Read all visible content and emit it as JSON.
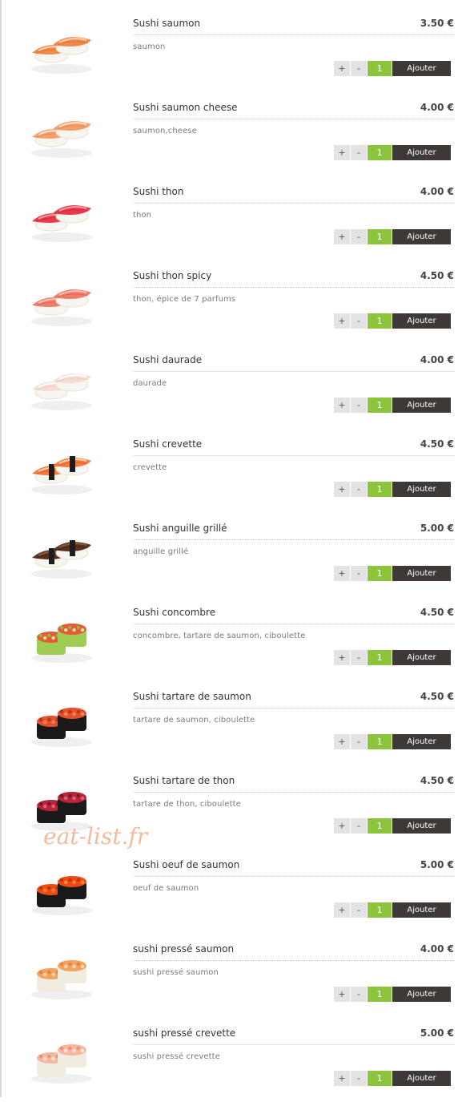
{
  "menu": {
    "items": [
      {
        "name": "Sushi saumon",
        "price": "3.50 €",
        "description": "saumon",
        "qty": "1",
        "plus": "+",
        "minus": "-",
        "add_label": "Ajouter",
        "icon": "salmon-nigiri-icon",
        "style": {
          "fish": "#f08a4b",
          "stripe": "#fbd3b5",
          "dark": "#d95f24",
          "band": null
        }
      },
      {
        "name": "Sushi saumon cheese",
        "price": "4.00 €",
        "description": "saumon,cheese",
        "qty": "1",
        "plus": "+",
        "minus": "-",
        "add_label": "Ajouter",
        "icon": "salmon-cheese-nigiri-icon",
        "style": {
          "fish": "#f4a06b",
          "stripe": "#fbe3d2",
          "dark": "#e27d43",
          "band": null
        }
      },
      {
        "name": "Sushi thon",
        "price": "4.00 €",
        "description": "thon",
        "qty": "1",
        "plus": "+",
        "minus": "-",
        "add_label": "Ajouter",
        "icon": "tuna-nigiri-icon",
        "style": {
          "fish": "#e9394a",
          "stripe": "#f7a0a8",
          "dark": "#c51f32",
          "band": null
        }
      },
      {
        "name": "Sushi thon spicy",
        "price": "4.50 €",
        "description": "thon, épice de 7 parfums",
        "qty": "1",
        "plus": "+",
        "minus": "-",
        "add_label": "Ajouter",
        "icon": "spicy-tuna-nigiri-icon",
        "style": {
          "fish": "#f07d6a",
          "stripe": "#f8c0b4",
          "dark": "#d9584a",
          "band": null
        }
      },
      {
        "name": "Sushi daurade",
        "price": "4.00 €",
        "description": "daurade",
        "qty": "1",
        "plus": "+",
        "minus": "-",
        "add_label": "Ajouter",
        "icon": "sea-bream-nigiri-icon",
        "style": {
          "fish": "#f6ddd3",
          "stripe": "#ffffff",
          "dark": "#e8bfb0",
          "band": null
        }
      },
      {
        "name": "Sushi crevette",
        "price": "4.50 €",
        "description": "crevette",
        "qty": "1",
        "plus": "+",
        "minus": "-",
        "add_label": "Ajouter",
        "icon": "shrimp-nigiri-icon",
        "style": {
          "fish": "#f27a3c",
          "stripe": "#fbd2b4",
          "dark": "#d4561c",
          "band": "#1d1d1d"
        }
      },
      {
        "name": "Sushi anguille grillé",
        "price": "5.00 €",
        "description": "anguille grillé",
        "qty": "1",
        "plus": "+",
        "minus": "-",
        "add_label": "Ajouter",
        "icon": "grilled-eel-nigiri-icon",
        "style": {
          "fish": "#5a3220",
          "stripe": "#8a5a3a",
          "dark": "#3a1e10",
          "band": "#1d1d1d"
        }
      },
      {
        "name": "Sushi concombre",
        "price": "4.50 €",
        "description": "concombre, tartare de saumon, ciboulette",
        "qty": "1",
        "plus": "+",
        "minus": "-",
        "add_label": "Ajouter",
        "icon": "cucumber-gunkan-icon",
        "style": {
          "fish": "#e8583a",
          "stripe": "#d9e8a0",
          "dark": "#8bbf3a",
          "band": "#9fcc52"
        }
      },
      {
        "name": "Sushi tartare de saumon",
        "price": "4.50 €",
        "description": "tartare de saumon, ciboulette",
        "qty": "1",
        "plus": "+",
        "minus": "-",
        "add_label": "Ajouter",
        "icon": "salmon-tartare-gunkan-icon",
        "style": {
          "fish": "#e6502c",
          "stripe": "#f28a5a",
          "dark": "#b8361a",
          "band": "#1a1a1a"
        }
      },
      {
        "name": "Sushi tartare de thon",
        "price": "4.50 €",
        "description": "tartare de thon, ciboulette",
        "qty": "1",
        "plus": "+",
        "minus": "-",
        "add_label": "Ajouter",
        "icon": "tuna-tartare-gunkan-icon",
        "style": {
          "fish": "#b8243a",
          "stripe": "#d9647a",
          "dark": "#7a1424",
          "band": "#1a1a1a"
        }
      },
      {
        "name": "Sushi oeuf de saumon",
        "price": "5.00 €",
        "description": "oeuf de saumon",
        "qty": "1",
        "plus": "+",
        "minus": "-",
        "add_label": "Ajouter",
        "icon": "salmon-roe-gunkan-icon",
        "style": {
          "fish": "#f04a14",
          "stripe": "#ff8a3a",
          "dark": "#c23008",
          "band": "#1a1a1a"
        }
      },
      {
        "name": "sushi pressé saumon",
        "price": "4.00 €",
        "description": "sushi pressé saumon",
        "qty": "1",
        "plus": "+",
        "minus": "-",
        "add_label": "Ajouter",
        "icon": "pressed-salmon-sushi-icon",
        "style": {
          "fish": "#f4a25e",
          "stripe": "#fcdcb8",
          "dark": "#e4843e",
          "band": "#f1ece0"
        }
      },
      {
        "name": "sushi pressé crevette",
        "price": "5.00 €",
        "description": "sushi pressé crevette",
        "qty": "1",
        "plus": "+",
        "minus": "-",
        "add_label": "Ajouter",
        "icon": "pressed-shrimp-sushi-icon",
        "style": {
          "fish": "#f6b6a2",
          "stripe": "#fde6dc",
          "dark": "#e8907a",
          "band": "#f1ece0"
        }
      }
    ]
  },
  "watermark": "eat-list.fr"
}
